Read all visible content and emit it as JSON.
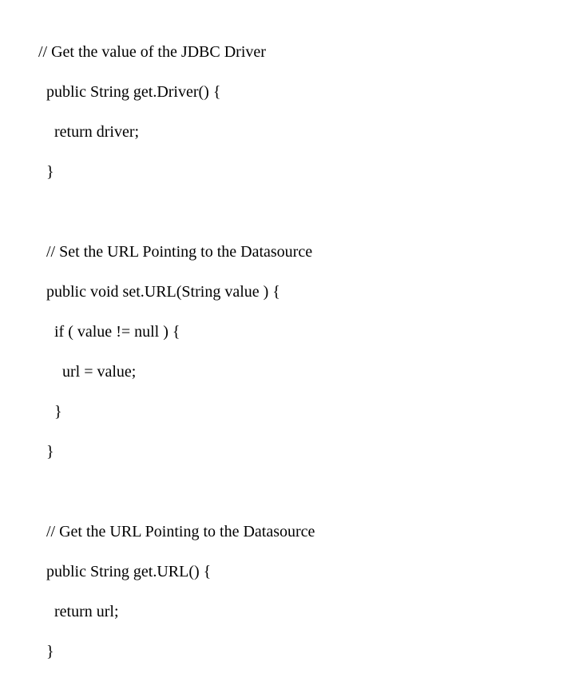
{
  "code": {
    "lines": [
      "// Get the value of the JDBC Driver",
      "  public String get.Driver() {",
      "    return driver;",
      "  }",
      "",
      "  // Set the URL Pointing to the Datasource",
      "  public void set.URL(String value ) {",
      "    if ( value != null ) {",
      "      url = value;",
      "    }",
      "  }",
      "",
      "  // Get the URL Pointing to the Datasource",
      "  public String get.URL() {",
      "    return url;",
      "  }"
    ]
  }
}
